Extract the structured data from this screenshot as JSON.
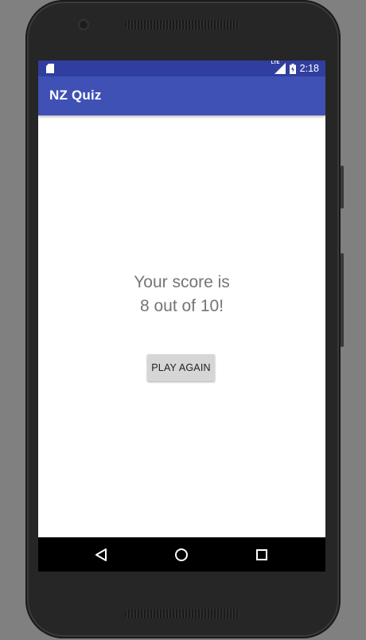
{
  "status_bar": {
    "network_label": "LTE",
    "time": "2:18",
    "color": "#303f9f"
  },
  "app_bar": {
    "title": "NZ Quiz",
    "color": "#3f51b5"
  },
  "main": {
    "score_line_1": "Your score is",
    "score_line_2": "8 out of 10!",
    "play_again_label": "PLAY AGAIN"
  },
  "nav_bar": {
    "back_icon": "back-triangle-icon",
    "home_icon": "home-circle-icon",
    "recents_icon": "recents-square-icon"
  }
}
